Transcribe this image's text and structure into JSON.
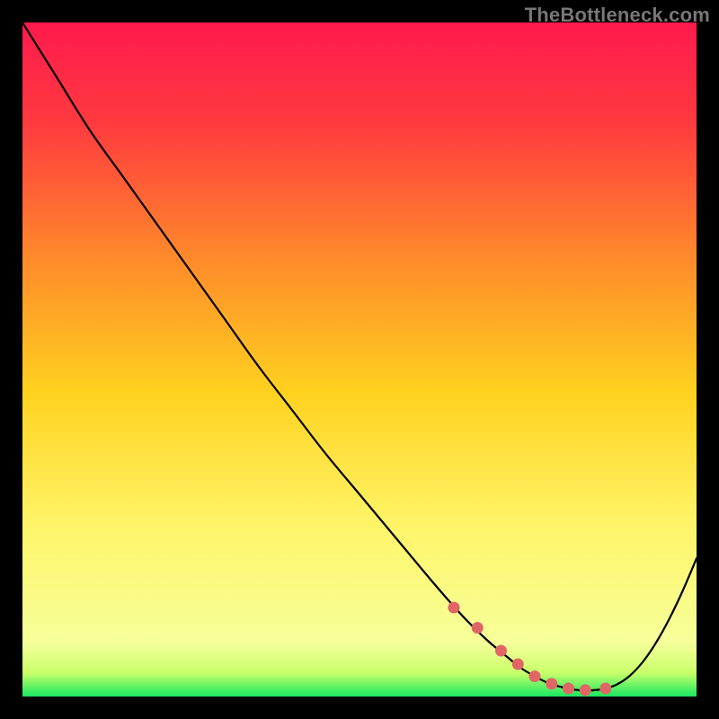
{
  "attribution": "TheBottleneck.com",
  "chart_data": {
    "type": "line",
    "title": "",
    "xlabel": "",
    "ylabel": "",
    "xlim": [
      0,
      100
    ],
    "ylim": [
      0,
      100
    ],
    "grid": false,
    "background_gradient": {
      "stops": [
        {
          "offset": 0.0,
          "color": "#ff1a4d"
        },
        {
          "offset": 0.15,
          "color": "#ff3a3f"
        },
        {
          "offset": 0.35,
          "color": "#ff8a2b"
        },
        {
          "offset": 0.55,
          "color": "#ffd21f"
        },
        {
          "offset": 0.75,
          "color": "#fff56a"
        },
        {
          "offset": 0.92,
          "color": "#f6ff9a"
        },
        {
          "offset": 0.965,
          "color": "#c8ff6a"
        },
        {
          "offset": 1.0,
          "color": "#18e860"
        }
      ]
    },
    "series": [
      {
        "name": "curve",
        "color": "#000000",
        "width": 2.2,
        "x": [
          0,
          5,
          10,
          15,
          20,
          25,
          30,
          35,
          40,
          45,
          50,
          55,
          60,
          63,
          66,
          69,
          72,
          74,
          76,
          78,
          80,
          82,
          84,
          86,
          88,
          90,
          92,
          94,
          96,
          98,
          100
        ],
        "y": [
          100,
          92,
          84,
          77,
          70,
          63,
          56,
          49,
          42.5,
          36,
          30,
          24,
          18,
          14.5,
          11.2,
          8.3,
          5.8,
          4.2,
          3.0,
          2.0,
          1.4,
          1.0,
          0.9,
          1.1,
          1.7,
          3.0,
          5.1,
          8.0,
          11.6,
          15.8,
          20.5
        ]
      }
    ],
    "markers": [
      {
        "name": "highlight-dots",
        "shape": "circle",
        "color": "#e06666",
        "radius": 6.5,
        "x": [
          64,
          67.5,
          71,
          73.5,
          76,
          78.5,
          81,
          83.5,
          86.5
        ],
        "y": [
          13.2,
          10.2,
          6.8,
          4.8,
          3.0,
          1.9,
          1.2,
          0.95,
          1.2
        ]
      }
    ]
  }
}
